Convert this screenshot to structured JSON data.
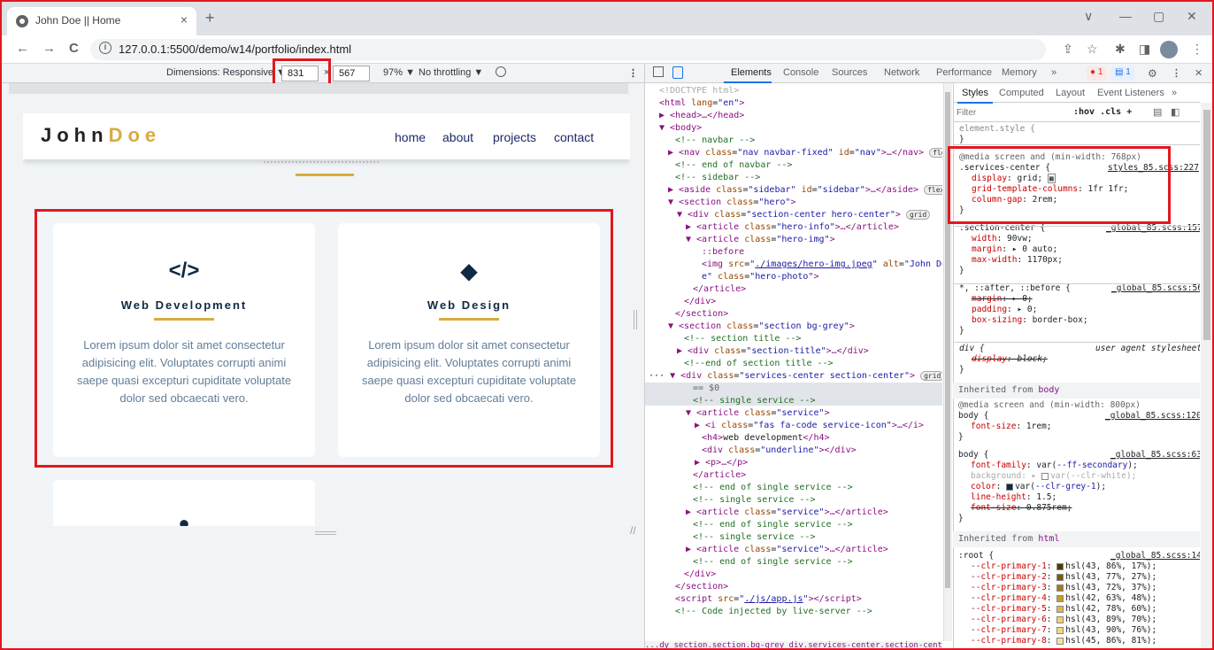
{
  "browser": {
    "tab_title": "John Doe || Home",
    "tab_close": "×",
    "new_tab": "+",
    "url": "127.0.0.1:5500/demo/w14/portfolio/index.html",
    "window_controls": [
      "∨",
      "—",
      "▢",
      "✕"
    ],
    "nav_icons": [
      "←",
      "→",
      "C"
    ],
    "toolbar_icons": [
      "⇪",
      "☆",
      "✱",
      "◨",
      "⋮"
    ]
  },
  "device_toolbar": {
    "dimensions_label": "Dimensions: Responsive ▼",
    "width": "831",
    "times": "×",
    "height": "567",
    "zoom": "97% ▼",
    "throttling": "No throttling ▼",
    "rotate_icon": "⃠",
    "more": "⋮"
  },
  "site": {
    "logo_a": "John",
    "logo_b": "Doe",
    "nav": [
      "home",
      "about",
      "projects",
      "contact"
    ],
    "services": [
      {
        "icon": "</>",
        "title": "Web Development",
        "text": "Lorem ipsum dolor sit amet consectetur adipisicing elit. Voluptates corrupti animi saepe quasi excepturi cupiditate voluptate dolor sed obcaecati vero."
      },
      {
        "icon": "◆",
        "title": "Web Design",
        "text": "Lorem ipsum dolor sit amet consectetur adipisicing elit. Voluptates corrupti animi saepe quasi excepturi cupiditate voluptate dolor sed obcaecati vero."
      },
      {
        "icon": "●"
      }
    ]
  },
  "devtools": {
    "tabs": [
      "Elements",
      "Console",
      "Sources",
      "Network",
      "Performance",
      "Memory",
      "»"
    ],
    "errors": "1",
    "messages": "1",
    "gear": "⚙",
    "more": "⋮",
    "close": "✕",
    "breadcrumbs": "...dy   section.section.bg-grey   div.services-center.section-center   ..."
  },
  "styles": {
    "tabs": [
      "Styles",
      "Computed",
      "Layout",
      "Event Listeners",
      "»"
    ],
    "filter_placeholder": "Filter",
    "filter_tools": ":hov  .cls  +",
    "inherited_body": "Inherited from ",
    "inherited_body_el": "body",
    "inherited_html": "Inherited from ",
    "inherited_html_el": "html"
  }
}
